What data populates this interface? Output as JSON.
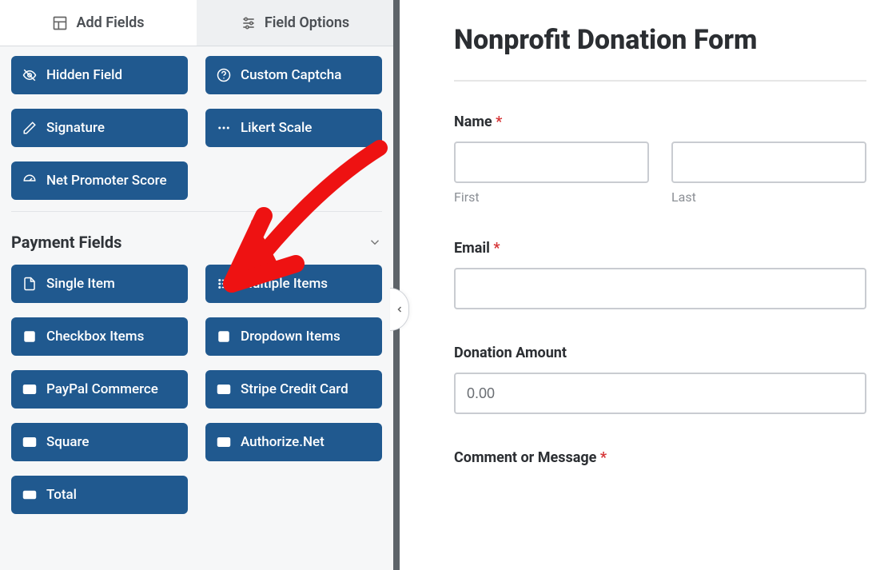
{
  "tabs": {
    "add_fields": "Add Fields",
    "field_options": "Field Options"
  },
  "fancy_fields": {
    "hidden_field": "Hidden Field",
    "custom_captcha": "Custom Captcha",
    "signature": "Signature",
    "likert_scale": "Likert Scale",
    "net_promoter": "Net Promoter Score"
  },
  "sections": {
    "payment_fields": "Payment Fields"
  },
  "payment_fields": {
    "single_item": "Single Item",
    "multiple_items": "Multiple Items",
    "checkbox_items": "Checkbox Items",
    "dropdown_items": "Dropdown Items",
    "paypal_commerce": "PayPal Commerce",
    "stripe_cc": "Stripe Credit Card",
    "square": "Square",
    "authorize_net": "Authorize.Net",
    "total": "Total"
  },
  "form": {
    "title": "Nonprofit Donation Form",
    "name_label": "Name",
    "first_sub": "First",
    "last_sub": "Last",
    "email_label": "Email",
    "donation_label": "Donation Amount",
    "donation_value": "0.00",
    "comment_label": "Comment or Message",
    "required": "*"
  }
}
